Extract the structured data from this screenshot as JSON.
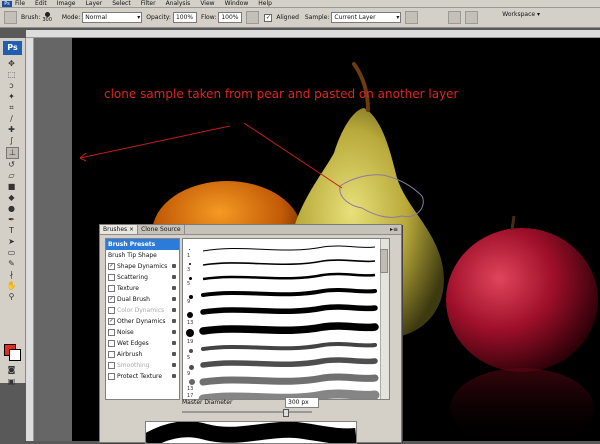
{
  "menu": {
    "items": [
      "File",
      "Edit",
      "Image",
      "Layer",
      "Select",
      "Filter",
      "Analysis",
      "View",
      "Window",
      "Help"
    ],
    "app_badge": "Ps"
  },
  "options_bar": {
    "brush_label": "Brush:",
    "brush_size": "300",
    "mode_label": "Mode:",
    "mode_value": "Normal",
    "opacity_label": "Opacity:",
    "opacity_value": "100%",
    "flow_label": "Flow:",
    "flow_value": "100%",
    "aligned_label": "Aligned",
    "aligned_checked": true,
    "sample_label": "Sample:",
    "sample_value": "Current Layer",
    "workspace_label": "Workspace"
  },
  "toolbox": {
    "logo": "Ps",
    "foreground_color": "#e52b1c",
    "background_color": "#ffffff"
  },
  "canvas": {
    "annotation": "clone sample taken from pear and pasted on another layer",
    "annotation_color": "#e0241c",
    "background": "#000000"
  },
  "brushes_panel": {
    "tabs": [
      "Brushes ×",
      "Clone Source"
    ],
    "active_tab": "Brushes ×",
    "options": [
      {
        "label": "Brush Presets",
        "checkbox": false,
        "checked": false,
        "lock": false,
        "disabled": false,
        "header": true
      },
      {
        "label": "Brush Tip Shape",
        "checkbox": false,
        "checked": false,
        "lock": false,
        "disabled": false
      },
      {
        "label": "Shape Dynamics",
        "checkbox": true,
        "checked": true,
        "lock": true,
        "disabled": false
      },
      {
        "label": "Scattering",
        "checkbox": true,
        "checked": false,
        "lock": true,
        "disabled": false
      },
      {
        "label": "Texture",
        "checkbox": true,
        "checked": false,
        "lock": true,
        "disabled": false
      },
      {
        "label": "Dual Brush",
        "checkbox": true,
        "checked": true,
        "lock": true,
        "disabled": false
      },
      {
        "label": "Color Dynamics",
        "checkbox": true,
        "checked": false,
        "lock": true,
        "disabled": true
      },
      {
        "label": "Other Dynamics",
        "checkbox": true,
        "checked": true,
        "lock": true,
        "disabled": false
      },
      {
        "label": "Noise",
        "checkbox": true,
        "checked": false,
        "lock": true,
        "disabled": false
      },
      {
        "label": "Wet Edges",
        "checkbox": true,
        "checked": false,
        "lock": true,
        "disabled": false
      },
      {
        "label": "Airbrush",
        "checkbox": true,
        "checked": false,
        "lock": true,
        "disabled": false
      },
      {
        "label": "Smoothing",
        "checkbox": true,
        "checked": false,
        "lock": true,
        "disabled": true
      },
      {
        "label": "Protect Texture",
        "checkbox": true,
        "checked": false,
        "lock": true,
        "disabled": false
      }
    ],
    "preset_numbers": [
      "1",
      "3",
      "5",
      "9",
      "13",
      "19",
      "5",
      "9",
      "13",
      "17"
    ],
    "master_diameter_label": "Master Diameter",
    "master_diameter_value": "300 px",
    "master_diameter_fraction": 0.78
  }
}
